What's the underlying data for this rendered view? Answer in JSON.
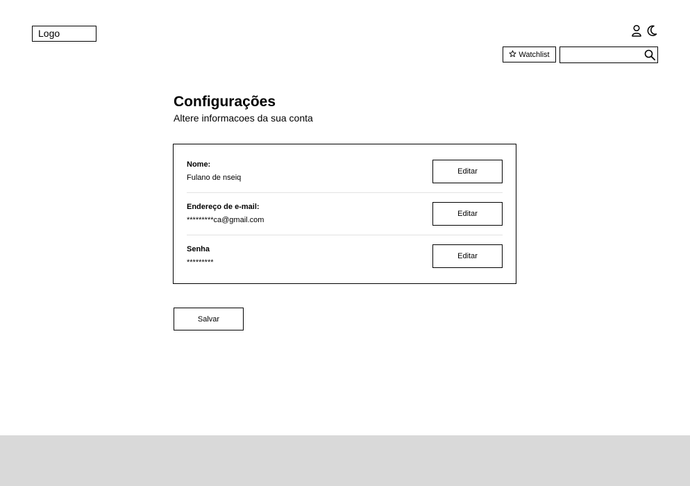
{
  "header": {
    "logo": "Logo",
    "watchlist_label": "Watchlist",
    "search": {
      "value": "",
      "placeholder": ""
    },
    "icons": [
      "user-icon",
      "moon-icon",
      "star-icon",
      "search-icon"
    ]
  },
  "page": {
    "title": "Configurações",
    "subtitle": "Altere informacoes da sua conta"
  },
  "account": {
    "fields": [
      {
        "label": "Nome:",
        "value": "Fulano de nseiq",
        "action": "Editar"
      },
      {
        "label": "Endereço de e-mail:",
        "value": "*********ca@gmail.com",
        "action": "Editar"
      },
      {
        "label": "Senha",
        "value": "*********",
        "action": "Editar"
      }
    ]
  },
  "actions": {
    "save_label": "Salvar"
  },
  "colors": {
    "footer": "#d9d9d9",
    "border": "#000000",
    "divider": "#e2e2e2"
  }
}
